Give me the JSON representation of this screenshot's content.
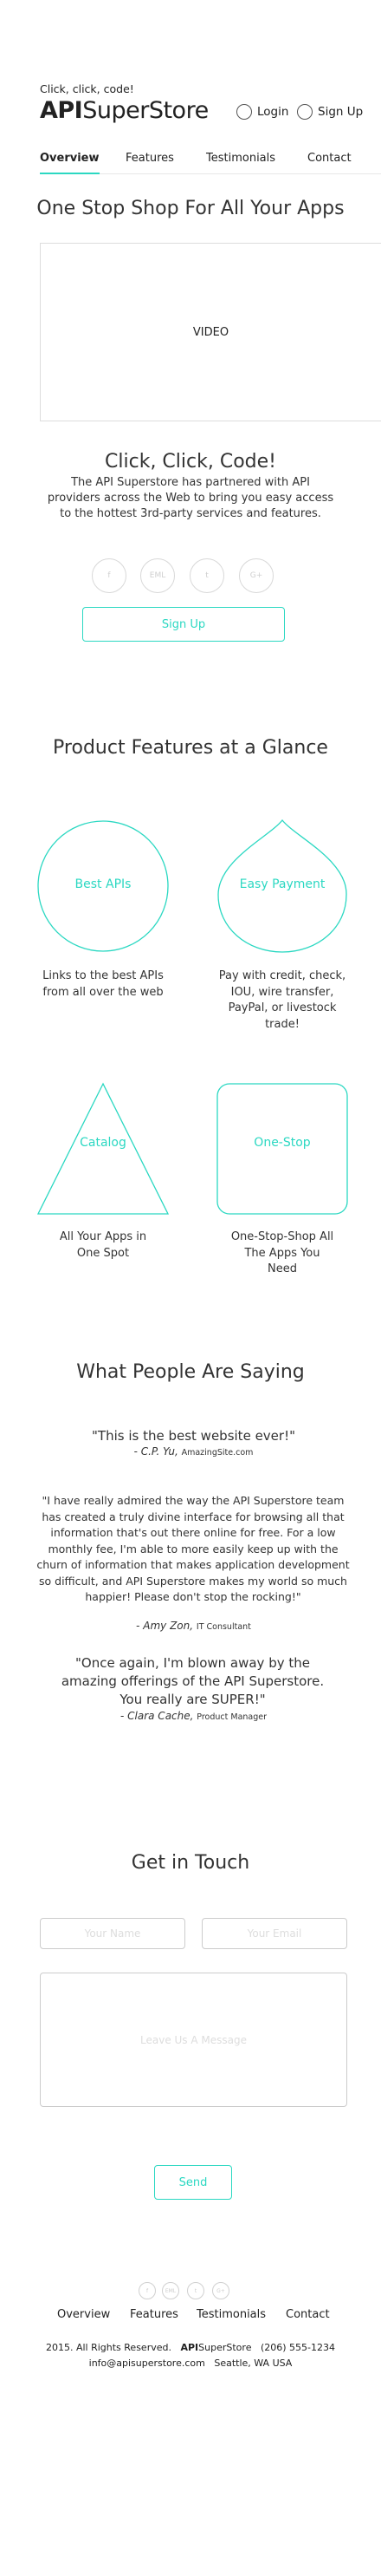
{
  "header": {
    "tagline": "Click, click, code!",
    "brand_bold": "API",
    "brand_rest": "SuperStore",
    "login_label": "Login",
    "signup_label": "Sign Up"
  },
  "nav": {
    "items": [
      {
        "label": "Overview",
        "active": true
      },
      {
        "label": "Features"
      },
      {
        "label": "Testimonials"
      },
      {
        "label": "Contact"
      }
    ]
  },
  "hero": {
    "title": "One Stop Shop For All Your Apps",
    "video_label": "VIDEO",
    "subtitle": "Click, Click, Code!",
    "description": "The API Superstore has partnered with API providers across the Web to bring you easy access to the hottest 3rd-party services and features.",
    "social": [
      "f",
      "EML",
      "t",
      "G+"
    ],
    "signup_button": "Sign Up"
  },
  "features": {
    "title": "Product Features at a Glance",
    "items": [
      {
        "label": "Best APIs",
        "text": "Links to the best APIs from all over the web"
      },
      {
        "label": "Easy Payment",
        "text": "Pay with credit, check, IOU, wire transfer, PayPal, or livestock trade!"
      },
      {
        "label": "Catalog",
        "text": "All Your Apps in One Spot"
      },
      {
        "label": "One-Stop",
        "text": "One-Stop-Shop All The Apps You Need"
      }
    ]
  },
  "testimonials": {
    "title": "What People Are Saying",
    "items": [
      {
        "quote": "\"This is the best website ever!\"",
        "name": "C.P. Yu,",
        "org": "AmazingSite.com"
      },
      {
        "quote": "\"I have really admired the way the API Superstore team has created a truly divine interface for browsing all that information that's out there online for free. For a low monthly fee, I'm able to more easily keep up with the churn of information that makes application development so difficult, and API Superstore makes my world so much happier! Please don't stop the rocking!\"",
        "name": "Amy Zon,",
        "org": "IT Consultant"
      },
      {
        "quote": "\"Once again, I'm blown away by the amazing offerings of the API Superstore. You really are SUPER!\"",
        "name": "Clara Cache,",
        "org": "Product Manager"
      }
    ]
  },
  "contact": {
    "title": "Get in Touch",
    "name_placeholder": "Your Name",
    "email_placeholder": "Your Email",
    "message_placeholder": "Leave Us A Message",
    "send_button": "Send"
  },
  "footer": {
    "social": [
      "f",
      "EML",
      "t",
      "G+"
    ],
    "nav": [
      "Overview",
      "Features",
      "Testimonials",
      "Contact"
    ],
    "copyright": "2015.  All Rights Reserved.",
    "brand_bold": "API",
    "brand_rest": "SuperStore",
    "phone": "(206) 555-1234",
    "email": "info@apisuperstore.com",
    "location": "Seattle, WA USA"
  },
  "colors": {
    "accent": "#2bd8c2"
  }
}
